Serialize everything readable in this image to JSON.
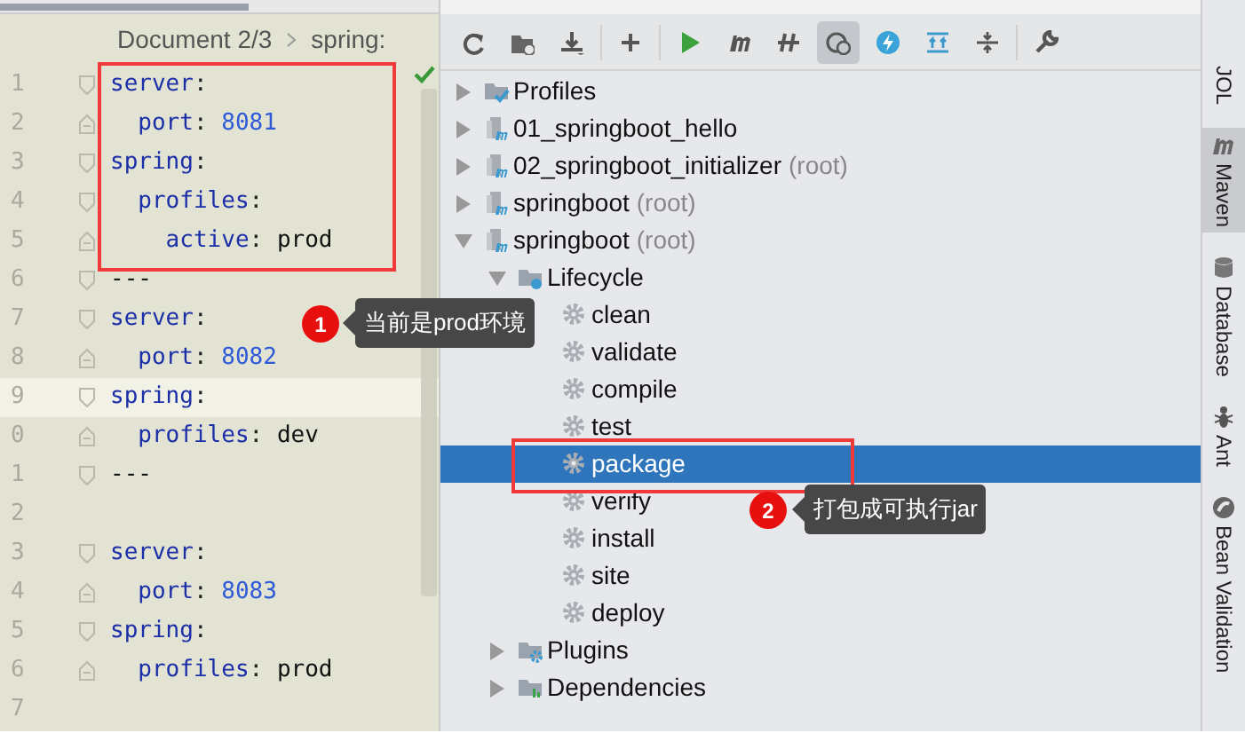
{
  "editor": {
    "breadcrumb": [
      "Document 2/3",
      "spring:"
    ],
    "inspection_ok": true,
    "lines": [
      {
        "number": "1",
        "kind": "block-start",
        "current": false,
        "segments": [
          {
            "kind": "key",
            "text": "server"
          },
          {
            "kind": "punct",
            "text": ":"
          }
        ]
      },
      {
        "number": "2",
        "kind": "block-end",
        "current": false,
        "segments": [
          {
            "kind": "key",
            "text": "  port"
          },
          {
            "kind": "punct",
            "text": ": "
          },
          {
            "kind": "number",
            "text": "8081"
          }
        ]
      },
      {
        "number": "3",
        "kind": "block-start",
        "current": false,
        "segments": [
          {
            "kind": "key",
            "text": "spring"
          },
          {
            "kind": "punct",
            "text": ":"
          }
        ]
      },
      {
        "number": "4",
        "kind": "block-start",
        "current": false,
        "segments": [
          {
            "kind": "key",
            "text": "  profiles"
          },
          {
            "kind": "punct",
            "text": ":"
          }
        ]
      },
      {
        "number": "5",
        "kind": "block-end",
        "current": false,
        "segments": [
          {
            "kind": "key",
            "text": "    active"
          },
          {
            "kind": "punct",
            "text": ": "
          },
          {
            "kind": "text",
            "text": "prod"
          }
        ]
      },
      {
        "number": "6",
        "kind": "block-start",
        "current": false,
        "segments": [
          {
            "kind": "text",
            "text": "---"
          }
        ]
      },
      {
        "number": "7",
        "kind": "block-start",
        "current": false,
        "segments": [
          {
            "kind": "key",
            "text": "server"
          },
          {
            "kind": "punct",
            "text": ":"
          }
        ]
      },
      {
        "number": "8",
        "kind": "block-end",
        "current": false,
        "segments": [
          {
            "kind": "key",
            "text": "  port"
          },
          {
            "kind": "punct",
            "text": ": "
          },
          {
            "kind": "number",
            "text": "8082"
          }
        ]
      },
      {
        "number": "9",
        "kind": "block-start",
        "current": true,
        "segments": [
          {
            "kind": "key",
            "text": "spring"
          },
          {
            "kind": "punct",
            "text": ":"
          }
        ]
      },
      {
        "number": "0",
        "kind": "block-end",
        "current": false,
        "segments": [
          {
            "kind": "key",
            "text": "  profiles"
          },
          {
            "kind": "punct",
            "text": ": "
          },
          {
            "kind": "text",
            "text": "dev"
          }
        ]
      },
      {
        "number": "1",
        "kind": "block-start",
        "current": false,
        "segments": [
          {
            "kind": "text",
            "text": "---"
          }
        ]
      },
      {
        "number": "2",
        "kind": "plain",
        "current": false
      },
      {
        "number": "3",
        "kind": "block-start",
        "current": false,
        "segments": [
          {
            "kind": "key",
            "text": "server"
          },
          {
            "kind": "punct",
            "text": ":"
          }
        ]
      },
      {
        "number": "4",
        "kind": "block-end",
        "current": false,
        "segments": [
          {
            "kind": "key",
            "text": "  port"
          },
          {
            "kind": "punct",
            "text": ": "
          },
          {
            "kind": "number",
            "text": "8083"
          }
        ]
      },
      {
        "number": "5",
        "kind": "block-start",
        "current": false,
        "segments": [
          {
            "kind": "key",
            "text": "spring"
          },
          {
            "kind": "punct",
            "text": ":"
          }
        ]
      },
      {
        "number": "6",
        "kind": "block-end",
        "current": false,
        "segments": [
          {
            "kind": "key",
            "text": "  profiles"
          },
          {
            "kind": "punct",
            "text": ": "
          },
          {
            "kind": "text",
            "text": "prod"
          }
        ]
      },
      {
        "number": "7",
        "kind": "plain",
        "current": false
      }
    ]
  },
  "maven": {
    "toolbar": [
      {
        "kind": "reload",
        "selected": false
      },
      {
        "kind": "folder-refresh",
        "selected": false
      },
      {
        "kind": "download",
        "selected": false
      },
      {
        "kind": "add",
        "selected": false
      },
      {
        "kind": "run",
        "selected": false
      },
      {
        "kind": "maven",
        "selected": false
      },
      {
        "kind": "offline",
        "selected": false
      },
      {
        "kind": "skip-tests",
        "selected": true
      },
      {
        "kind": "lightning",
        "selected": false
      },
      {
        "kind": "expand",
        "selected": false
      },
      {
        "kind": "collapse",
        "selected": false
      },
      {
        "kind": "wrench",
        "selected": false
      }
    ],
    "tree": [
      {
        "kind": "profiles",
        "label": "Profiles",
        "expanded": false,
        "selected": false
      },
      {
        "kind": "module",
        "label": "01_springboot_hello",
        "expanded": false,
        "selected": false
      },
      {
        "kind": "module",
        "label": "02_springboot_initializer",
        "suffix": "(root)",
        "expanded": false,
        "selected": false
      },
      {
        "kind": "module",
        "label": "springboot",
        "suffix": "(root)",
        "expanded": false,
        "selected": false
      },
      {
        "kind": "module",
        "label": "springboot",
        "suffix": "(root)",
        "expanded": true,
        "selected": false,
        "children": [
          {
            "kind": "lifecycle",
            "label": "Lifecycle",
            "expanded": true,
            "selected": false,
            "children": [
              {
                "kind": "goal",
                "label": "clean",
                "selected": false
              },
              {
                "kind": "goal",
                "label": "validate",
                "selected": false
              },
              {
                "kind": "goal",
                "label": "compile",
                "selected": false
              },
              {
                "kind": "goal",
                "label": "test",
                "selected": false
              },
              {
                "kind": "goal",
                "label": "package",
                "selected": true
              },
              {
                "kind": "goal",
                "label": "verify",
                "selected": false
              },
              {
                "kind": "goal",
                "label": "install",
                "selected": false
              },
              {
                "kind": "goal",
                "label": "site",
                "selected": false
              },
              {
                "kind": "goal",
                "label": "deploy",
                "selected": false
              }
            ]
          },
          {
            "kind": "plugins",
            "label": "Plugins",
            "expanded": false,
            "selected": false
          },
          {
            "kind": "dependencies",
            "label": "Dependencies",
            "expanded": false,
            "selected": false
          }
        ]
      }
    ]
  },
  "side_tabs": [
    {
      "kind": "plain",
      "label": "JOL",
      "selected": false
    },
    {
      "kind": "maven",
      "label": "Maven",
      "selected": true
    },
    {
      "kind": "database",
      "label": "Database",
      "selected": false
    },
    {
      "kind": "ant",
      "label": "Ant",
      "selected": false
    },
    {
      "kind": "bean",
      "label": "Bean Validation",
      "selected": false
    }
  ],
  "annotations": [
    {
      "number": "1",
      "text": "当前是prod环境"
    },
    {
      "number": "2",
      "text": "打包成可执行jar"
    }
  ]
}
